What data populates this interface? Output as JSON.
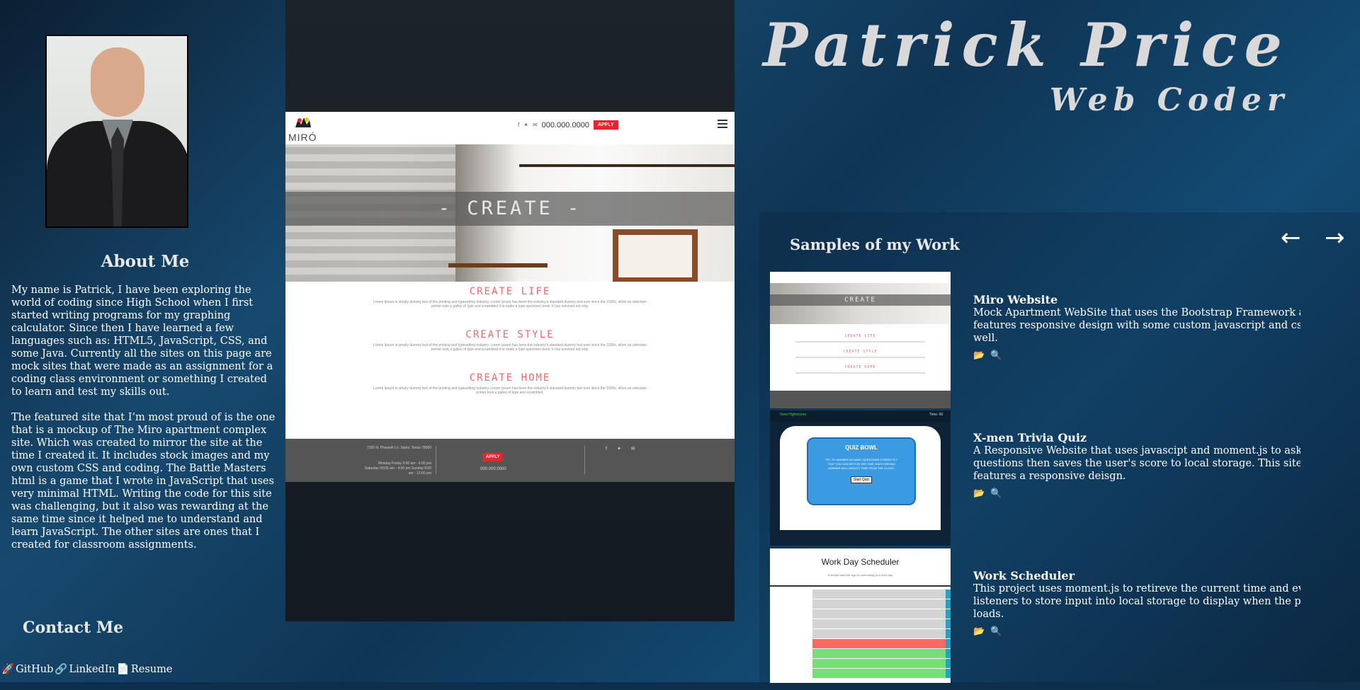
{
  "header": {
    "name": "Patrick Price",
    "role": "Web Coder"
  },
  "about": {
    "title": "About Me",
    "paragraph_1": "My name is Patrick, I have been exploring the world of coding since High School when I first started writing programs for my graphing calculator. Since then I have learned a few languages such as: HTML5, JavaScript, CSS, and some Java. Currently all the sites on this page are mock sites that were made as an assignment for a coding class environment or something I created to learn and test my skills out.",
    "paragraph_2": "The featured site that I’m most proud of is the one that is a mockup of The Miro apartment complex site. Which was created to mirror the site at the time I created it. It includes stock images and my own custom CSS and coding. The Battle Masters html is a game that I wrote in JavaScript that uses very minimal HTML. Writing the code for this site was challenging, but it also was rewarding at the same time since it helped me to understand and learn JavaScript. The other sites are ones that I created for classroom assignments."
  },
  "contact": {
    "title": "Contact Me",
    "links": [
      {
        "icon": "rocket-icon",
        "glyph": "🚀",
        "label": "GitHub"
      },
      {
        "icon": "paperclip-icon",
        "glyph": "🔗",
        "label": "LinkedIn"
      },
      {
        "icon": "document-icon",
        "glyph": "📄",
        "label": "Resume"
      }
    ]
  },
  "featured": {
    "logo": "MIRÓ",
    "phone": "000.000.0000",
    "apply": "APPLY",
    "hero_title": "- CREATE -",
    "sections": [
      {
        "title": "CREATE LIFE",
        "body": "Lorem Ipsum is simply dummy text of the printing and typesetting industry. Lorem Ipsum has been the industry's standard dummy text ever since the 1500s, when an unknown printer took a galley of type and scrambled it to make a type specimen book. It has survived not only."
      },
      {
        "title": "CREATE STYLE",
        "body": "Lorem Ipsum is simply dummy text of the printing and typesetting industry. Lorem Ipsum has been the industry's standard dummy text ever since the 1500s, when an unknown printer took a galley of type and scrambled it to make a type specimen book. It has survived not only."
      },
      {
        "title": "CREATE HOME",
        "body": "Lorem Ipsum is simply dummy text of the printing and typesetting industry. Lorem Ipsum has been the industry's standard dummy text ever since the 1500s, when an unknown printer took a galley of type and scrambled."
      }
    ],
    "footer_address": "7305 N. Pharaoh Ln. Sales, Texas 78000",
    "footer_hours": "Monday-Friday 9:00 am - 6:00 pm Saturday 09:00 am - 4:00 pm Sunday 8:00 am - 12:00 pm",
    "footer_phone": "000.000.0000"
  },
  "samples": {
    "title": "Samples of my Work",
    "prev_label": "←",
    "next_label": "→",
    "items": [
      {
        "title": "Miro Website",
        "description": "Mock Apartment WebSite that uses the Bootstrap Framework and features responsive design with some custom javascript and css as well.",
        "repo_icon": "📂",
        "view_icon": "🔍"
      },
      {
        "title": "X-men Trivia Quiz",
        "description": "A Responsive Website that uses javascipt and moment.js to ask trivia questions then saves the user's score to local storage. This site also features a responsive deisgn.",
        "repo_icon": "📂",
        "view_icon": "🔍"
      },
      {
        "title": "Work Scheduler",
        "description": "This project uses moment.js to retireve the current time and event listeners to store input into local storage to display when the page loads.",
        "repo_icon": "📂",
        "view_icon": "🔍"
      }
    ],
    "thumb_quiz": {
      "header": "View Highscores",
      "header_right": "Time: 60",
      "card_title": "QUIZ BOWL",
      "card_text": "TRY TO ANSWER AS MANY QUESTIONS CORRECTLY THAT YOU CAN WITH IN THE TIME. EACH WRONG ANSWER WILL DEDUCT TIME FROM THE CLOCK.",
      "card_button": "Start Quiz"
    },
    "thumb_scheduler": {
      "title": "Work Day Scheduler",
      "subtitle": "A simple calendar app for scheduling your work day"
    }
  },
  "colors": {
    "accent_red": "#e5262c",
    "section_pink": "#f16a6a",
    "scheduler_past": "#d3d3d3",
    "scheduler_present": "#ff6961",
    "scheduler_future": "#77dd77",
    "scheduler_save": "#1aa5c9"
  }
}
